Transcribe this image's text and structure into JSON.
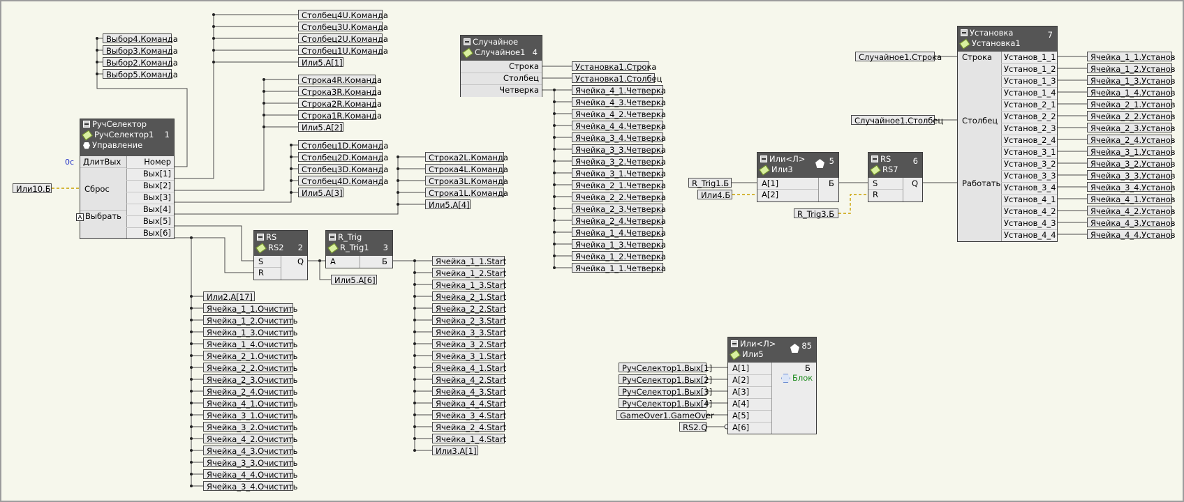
{
  "labels": {
    "vybor4": "Выбор4.Команда",
    "vybor3": "Выбор3.Команда",
    "vybor2": "Выбор2.Команда",
    "vybor5": "Выбор5.Команда",
    "st4u": "Столбец4U.Команда",
    "st3u": "Столбец3U.Команда",
    "st2u": "Столбец2U.Команда",
    "st1u": "Столбец1U.Команда",
    "ili5a1": "Или5.А[1]",
    "str4r": "Строка4R.Команда",
    "str3r": "Строка3R.Команда",
    "str2r": "Строка2R.Команда",
    "str1r": "Строка1R.Команда",
    "ili5a2": "Или5.А[2]",
    "st1d": "Столбец1D.Команда",
    "st2d": "Столбец2D.Команда",
    "st3d": "Столбец3D.Команда",
    "st4d": "Столбец4D.Команда",
    "ili5a3": "Или5.А[3]",
    "str2l": "Строка2L.Команда",
    "str4l": "Строка4L.Команда",
    "str3l": "Строка3L.Команда",
    "str1l": "Строка1L.Команда",
    "ili5a4": "Или5.А[4]",
    "ili10b": "Или10.Б",
    "ili5a6": "Или5.А[6]",
    "ili2a17": "Или2.А[17]",
    "ili3a1": "Или3.А[1]",
    "ust1str": "Установка1.Строка",
    "ust1stlb": "Установка1.Столбец",
    "rtrig1b": "R_Trig1.Б",
    "ili4b": "Или4.Б",
    "rtrig3b": "R_Trig3.Б",
    "sluch1str": "Случайное1.Строка",
    "sluch1stlb": "Случайное1.Столбец",
    "rs_vyh1": "РучСелектор1.Вых[1]",
    "rs_vyh2": "РучСелектор1.Вых[2]",
    "rs_vyh3": "РучСелектор1.Вых[3]",
    "rs_vyh4": "РучСелектор1.Вых[4]",
    "gameover": "GameOver1.GameOver",
    "rs2q": "RS2.Q"
  },
  "clear_list": [
    "Ячейка_1_1.Очистить",
    "Ячейка_1_2.Очистить",
    "Ячейка_1_3.Очистить",
    "Ячейка_1_4.Очистить",
    "Ячейка_2_1.Очистить",
    "Ячейка_2_2.Очистить",
    "Ячейка_2_3.Очистить",
    "Ячейка_2_4.Очистить",
    "Ячейка_4_1.Очистить",
    "Ячейка_3_1.Очистить",
    "Ячейка_3_2.Очистить",
    "Ячейка_4_2.Очистить",
    "Ячейка_4_3.Очистить",
    "Ячейка_3_3.Очистить",
    "Ячейка_4_4.Очистить",
    "Ячейка_3_4.Очистить"
  ],
  "start_list": [
    "Ячейка_1_1.Start",
    "Ячейка_1_2.Start",
    "Ячейка_1_3.Start",
    "Ячейка_2_1.Start",
    "Ячейка_2_2.Start",
    "Ячейка_2_3.Start",
    "Ячейка_3_3.Start",
    "Ячейка_3_2.Start",
    "Ячейка_3_1.Start",
    "Ячейка_4_1.Start",
    "Ячейка_4_2.Start",
    "Ячейка_4_3.Start",
    "Ячейка_4_4.Start",
    "Ячейка_3_4.Start",
    "Ячейка_2_4.Start",
    "Ячейка_1_4.Start"
  ],
  "chetv_list": [
    "Ячейка_4_1.Четверка",
    "Ячейка_4_3.Четверка",
    "Ячейка_4_2.Четверка",
    "Ячейка_4_4.Четверка",
    "Ячейка_3_4.Четверка",
    "Ячейка_3_3.Четверка",
    "Ячейка_3_2.Четверка",
    "Ячейка_3_1.Четверка",
    "Ячейка_2_1.Четверка",
    "Ячейка_2_2.Четверка",
    "Ячейка_2_3.Четверка",
    "Ячейка_2_4.Четверка",
    "Ячейка_1_4.Четверка",
    "Ячейка_1_3.Четверка",
    "Ячейка_1_2.Четверка",
    "Ячейка_1_1.Четверка"
  ],
  "ust_out_list": [
    "Ячейка_1_1.Установ",
    "Ячейка_1_2.Установ",
    "Ячейка_1_3.Установ",
    "Ячейка_1_4.Установ",
    "Ячейка_2_1.Установ",
    "Ячейка_2_2.Установ",
    "Ячейка_2_3.Установ",
    "Ячейка_2_4.Установ",
    "Ячейка_3_1.Установ",
    "Ячейка_3_2.Установ",
    "Ячейка_3_3.Установ",
    "Ячейка_3_4.Установ",
    "Ячейка_4_1.Установ",
    "Ячейка_4_2.Установ",
    "Ячейка_4_3.Установ",
    "Ячейка_4_4.Установ"
  ],
  "blocks": {
    "ruch": {
      "type": "РучСелектор",
      "name": "РучСелектор1",
      "extra": "Управление",
      "num": "1",
      "time": "0с",
      "in1": "ДлитВых",
      "in2": "Сброс",
      "in3": "Выбрать",
      "outs": [
        "Номер",
        "Вых[1]",
        "Вых[2]",
        "Вых[3]",
        "Вых[4]",
        "Вых[5]",
        "Вых[6]"
      ]
    },
    "sluch": {
      "type": "Случайное",
      "name": "Случайное1",
      "num": "4",
      "outs": [
        "Строка",
        "Столбец",
        "Четверка"
      ]
    },
    "rs2": {
      "type": "RS",
      "name": "RS2",
      "num": "2",
      "ins": [
        "S",
        "R"
      ],
      "out": "Q"
    },
    "rtrig": {
      "type": "R_Trig",
      "name": "R_Trig1",
      "num": "3",
      "in": "А",
      "out": "Б"
    },
    "ili3": {
      "type": "Или<Л>",
      "name": "Или3",
      "num": "5",
      "ins": [
        "А[1]",
        "А[2]"
      ],
      "out": "Б"
    },
    "rs7": {
      "type": "RS",
      "name": "RS7",
      "num": "6",
      "ins": [
        "S",
        "R"
      ],
      "out": "Q"
    },
    "ust": {
      "type": "Установка",
      "name": "Установка1",
      "num": "7",
      "ins": [
        "Строка",
        "Столбец",
        "Работать"
      ],
      "outs": [
        "Установ_1_1",
        "Установ_1_2",
        "Установ_1_3",
        "Установ_1_4",
        "Установ_2_1",
        "Установ_2_2",
        "Установ_2_3",
        "Установ_2_4",
        "Установ_3_1",
        "Установ_3_2",
        "Установ_3_3",
        "Установ_3_4",
        "Установ_4_1",
        "Установ_4_2",
        "Установ_4_3",
        "Установ_4_4"
      ]
    },
    "ili5": {
      "type": "Или<Л>",
      "name": "Или5",
      "num": "85",
      "ins": [
        "А[1]",
        "А[2]",
        "А[3]",
        "А[4]",
        "А[5]",
        "А[6]"
      ],
      "out": "Б",
      "extra": "Блок"
    }
  },
  "colors": {
    "background": "#f6f7ec",
    "block_header": "#555555",
    "wire": "#4a4a4a",
    "dashed_wire": "#c9a000",
    "time": "#1f2fc6",
    "block_text": "#1d8a1d"
  }
}
